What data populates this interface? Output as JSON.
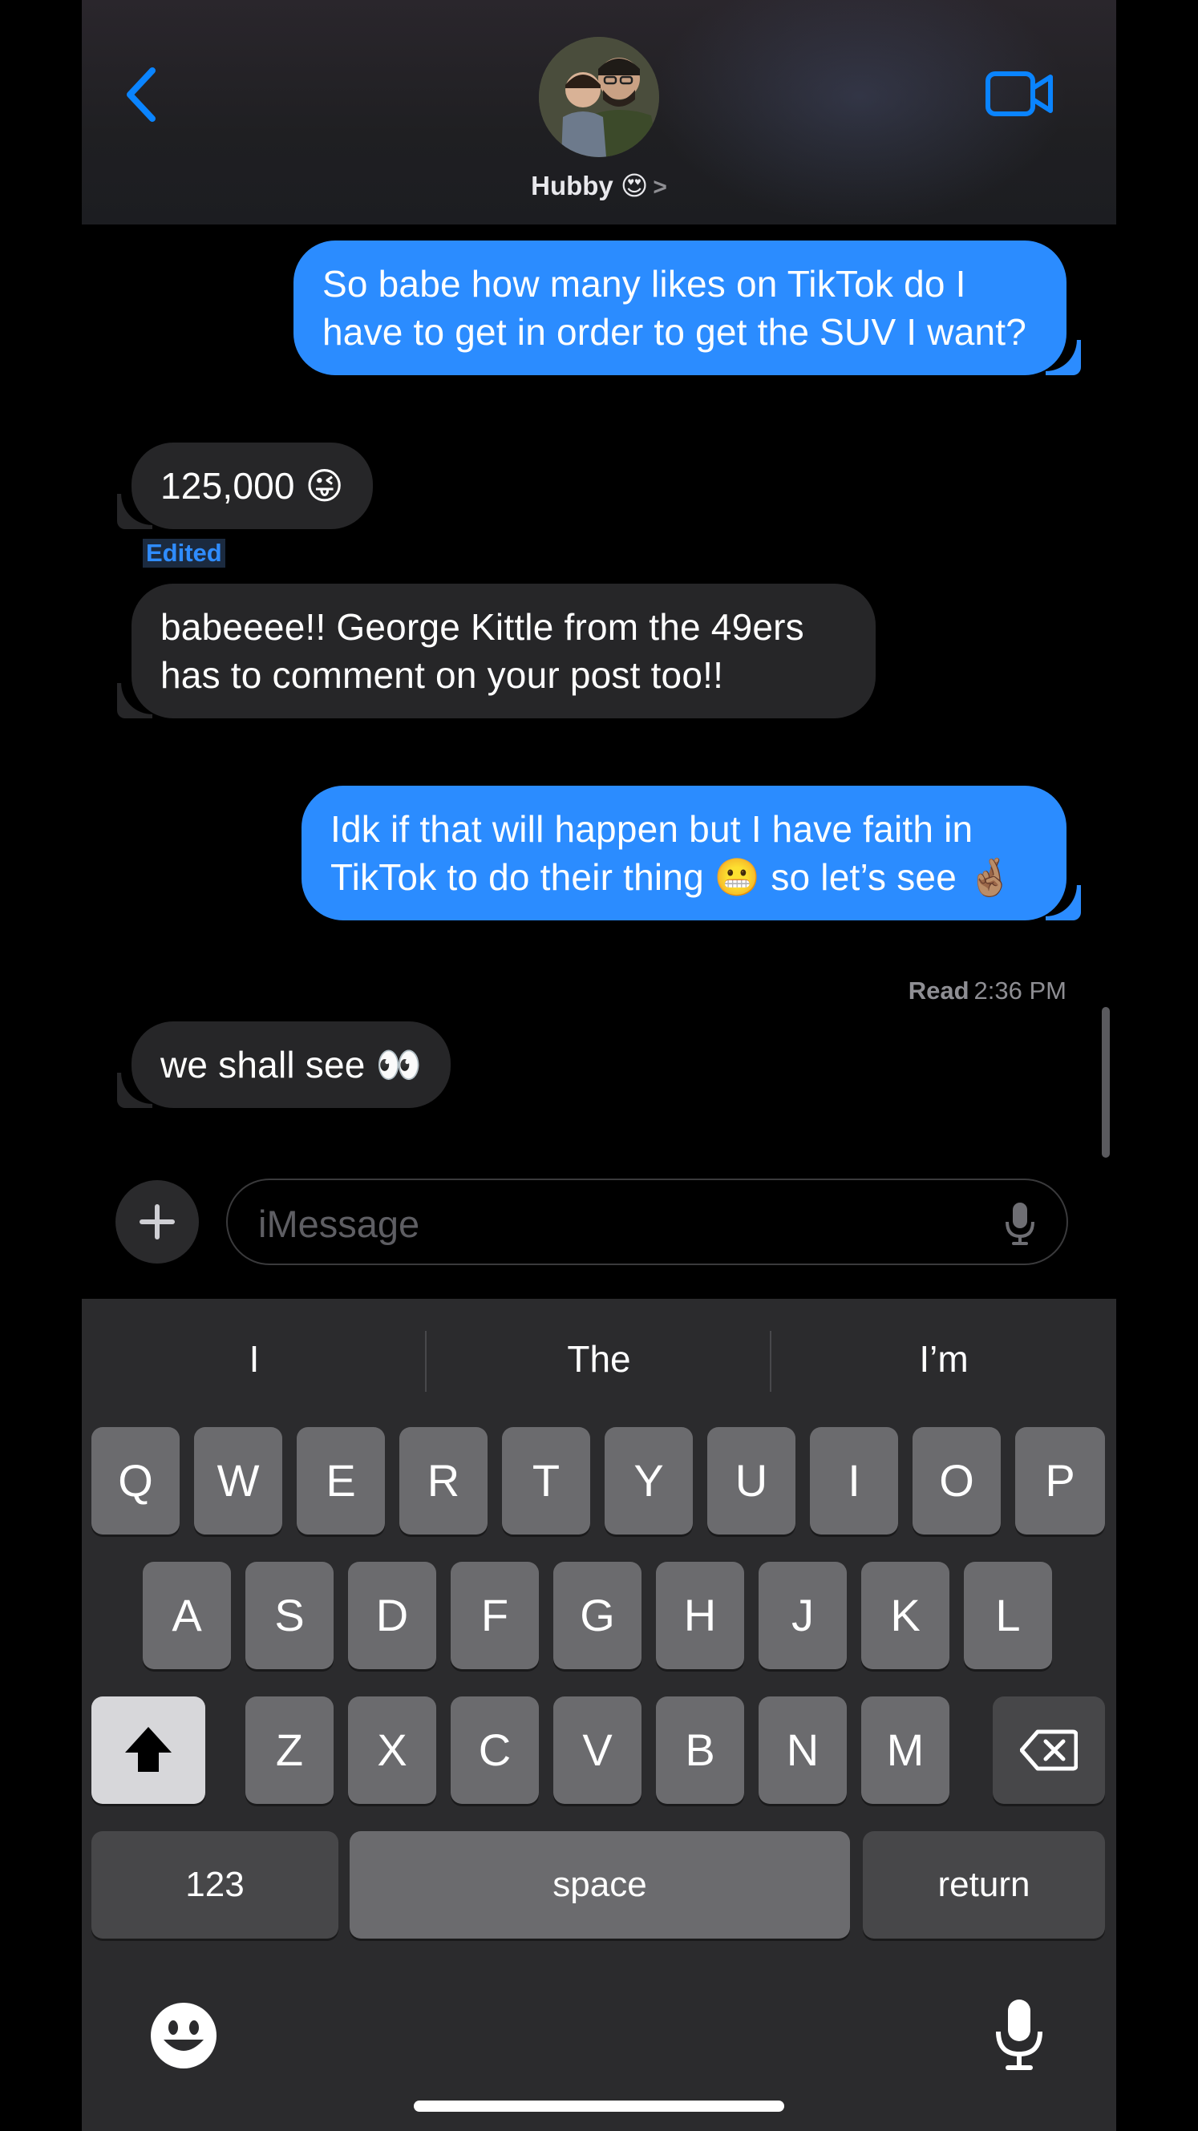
{
  "header": {
    "contact_name": "Hubby 😍",
    "chevron": ">"
  },
  "messages": [
    {
      "direction": "outgoing",
      "text": "So babe how many likes on TikTok do I have to get in order to get the SUV I want?"
    },
    {
      "direction": "incoming",
      "text": "125,000 😜"
    },
    {
      "direction": "incoming",
      "text": "babeeee!! George Kittle from the 49ers has to comment on your post too!!"
    },
    {
      "direction": "outgoing",
      "text": "Idk if that will happen but I have faith in TikTok to do their thing 😬 so let’s see 🤞🏽"
    },
    {
      "direction": "incoming",
      "text": "we shall see 👀"
    }
  ],
  "edited_label": "Edited",
  "read_receipt": {
    "label": "Read",
    "time": "2:36 PM"
  },
  "compose": {
    "placeholder": "iMessage"
  },
  "keyboard": {
    "suggestions": [
      "I",
      "The",
      "I’m"
    ],
    "row1": [
      "Q",
      "W",
      "E",
      "R",
      "T",
      "Y",
      "U",
      "I",
      "O",
      "P"
    ],
    "row2": [
      "A",
      "S",
      "D",
      "F",
      "G",
      "H",
      "J",
      "K",
      "L"
    ],
    "row3": [
      "Z",
      "X",
      "C",
      "V",
      "B",
      "N",
      "M"
    ],
    "numbers_label": "123",
    "space_label": "space",
    "return_label": "return"
  },
  "colors": {
    "outgoing_bubble": "#2b8cff",
    "incoming_bubble": "#262628",
    "accent": "#0a84ff",
    "keyboard_bg": "#2b2b2d",
    "key": "#6b6b6e"
  }
}
